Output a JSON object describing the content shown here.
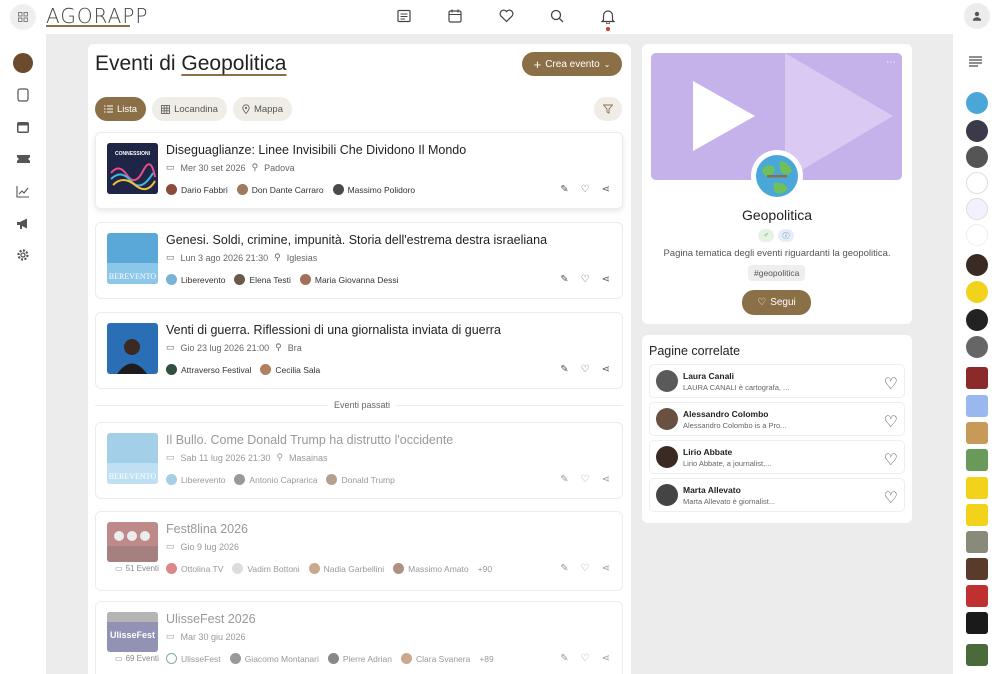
{
  "app": {
    "logo": "AGORAPP"
  },
  "page": {
    "title_prefix": "Eventi di",
    "title_topic": "Geopolitica",
    "create_label": "Crea evento"
  },
  "tabs": [
    {
      "label": "Lista",
      "icon": "list-icon",
      "active": true
    },
    {
      "label": "Locandina",
      "icon": "grid-icon",
      "active": false
    },
    {
      "label": "Mappa",
      "icon": "map-pin-icon",
      "active": false
    }
  ],
  "events": [
    {
      "title": "Diseguaglianze: Linee Invisibili Che Dividono Il Mondo",
      "date": "Mer 30 set 2026",
      "place": "Padova",
      "people": [
        "Dario Fabbri",
        "Don Dante Carraro",
        "Massimo Polidoro"
      ],
      "thumb_text": "CONNESSIONI"
    },
    {
      "title": "Genesi. Soldi, crimine, impunità. Storia dell'estrema destra israeliana",
      "date": "Lun 3 ago 2026 21:30",
      "place": "Iglesias",
      "people": [
        "Liberevento",
        "Elena Testi",
        "Maria Giovanna Dessi"
      ],
      "thumb_text": "BEREVENTO"
    },
    {
      "title": "Venti di guerra. Riflessioni di una giornalista inviata di guerra",
      "date": "Gio 23 lug 2026 21:00",
      "place": "Bra",
      "people": [
        "Attraverso Festival",
        "Cecilia Sala"
      ]
    }
  ],
  "past_label": "Eventi passati",
  "past_events": [
    {
      "title": "Il Bullo. Come Donald Trump ha distrutto l'occidente",
      "date": "Sab 11 lug 2026 21:30",
      "place": "Masainas",
      "people": [
        "Liberevento",
        "Antonio Caprarica",
        "Donald Trump"
      ],
      "thumb_text": "BEREVENTO"
    },
    {
      "title": "Fest8lina 2026",
      "date": "Gio 9 lug 2026",
      "count": "51 Eventi",
      "people": [
        "Ottolina TV",
        "Vadim Bottoni",
        "Nadia Garbellini",
        "Massimo Amato"
      ],
      "more": "+90"
    },
    {
      "title": "UlisseFest 2026",
      "date": "Mar 30 giu 2026",
      "count": "69 Eventi",
      "people": [
        "UlisseFest",
        "Giacomo Montanari",
        "Pierre Adrian",
        "Clara Svanera"
      ],
      "more": "+89",
      "thumb_text": "UlisseFest"
    }
  ],
  "profile": {
    "name": "Geopolitica",
    "description": "Pagina tematica degli eventi riguardanti la geopolitica.",
    "hashtag": "#geopolitica",
    "follow_label": "Segui"
  },
  "related": {
    "title": "Pagine correlate",
    "items": [
      {
        "name": "Laura Canali",
        "sub": "LAURA CANALI è cartografa, ..."
      },
      {
        "name": "Alessandro Colombo",
        "sub": "Alessandro Colombo is a Pro..."
      },
      {
        "name": "Lirio Abbate",
        "sub": "Lirio Abbate, a journalist,..."
      },
      {
        "name": "Marta Allevato",
        "sub": "Marta Allevato è giornalist..."
      }
    ]
  },
  "colors": {
    "accent": "#8b6f47",
    "banner": "#c6b2ea"
  }
}
